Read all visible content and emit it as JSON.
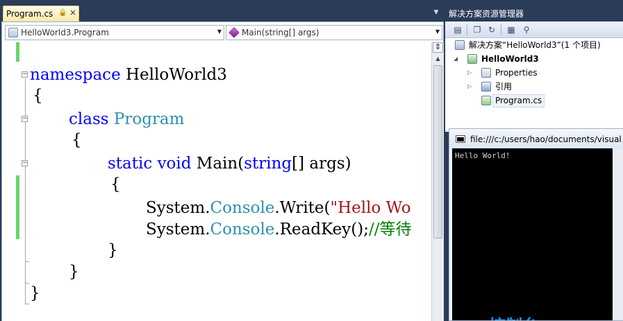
{
  "colors": {
    "chrome_background": "#2b3c59",
    "tab_active": "#fde9a8",
    "keyword": "#0000ff",
    "type_name": "#2b91af",
    "string": "#a31515",
    "comment": "#008000",
    "change_marker": "#6bd36b",
    "console_caption": "#1c8fe0"
  },
  "editor": {
    "tab": {
      "label": "Program.cs",
      "pin_icon": "pin-icon",
      "close_glyph": "×"
    },
    "nav_bar": {
      "type_combo": "HelloWorld3.Program",
      "member_combo": "Main(string[] args)"
    },
    "code": {
      "line1": {
        "keyword": "namespace",
        "rest": " HelloWorld3"
      },
      "line2": "{",
      "line3": {
        "keyword": "class",
        "type": "Program"
      },
      "line4": "{",
      "line5": {
        "kw1": "static",
        "kw2": "void",
        "name": "Main(",
        "kw3": "string",
        "rest": "[] args)"
      },
      "line6": "{",
      "line7": {
        "prefix": "System.",
        "type": "Console",
        "method": ".Write(",
        "string": "\"Hello Wo"
      },
      "line8": {
        "prefix": "System.",
        "type": "Console",
        "method": ".ReadKey();",
        "comment": "//等待"
      },
      "line9": "}",
      "line10": "}",
      "line11": "}"
    }
  },
  "solution_explorer": {
    "title": "解决方案资源管理器",
    "toolbar_icons": [
      "properties-icon",
      "show-all-files-icon",
      "refresh-icon",
      "view-code-icon",
      "class-diagram-icon"
    ],
    "tree": {
      "solution": "解决方案“HelloWorld3”(1 个项目)",
      "project": "HelloWorld3",
      "properties": "Properties",
      "references": "引用",
      "file": "Program.cs"
    }
  },
  "console": {
    "title": "file:///c:/users/hao/documents/visual s",
    "output": "Hello World!",
    "caption": "控制台"
  }
}
